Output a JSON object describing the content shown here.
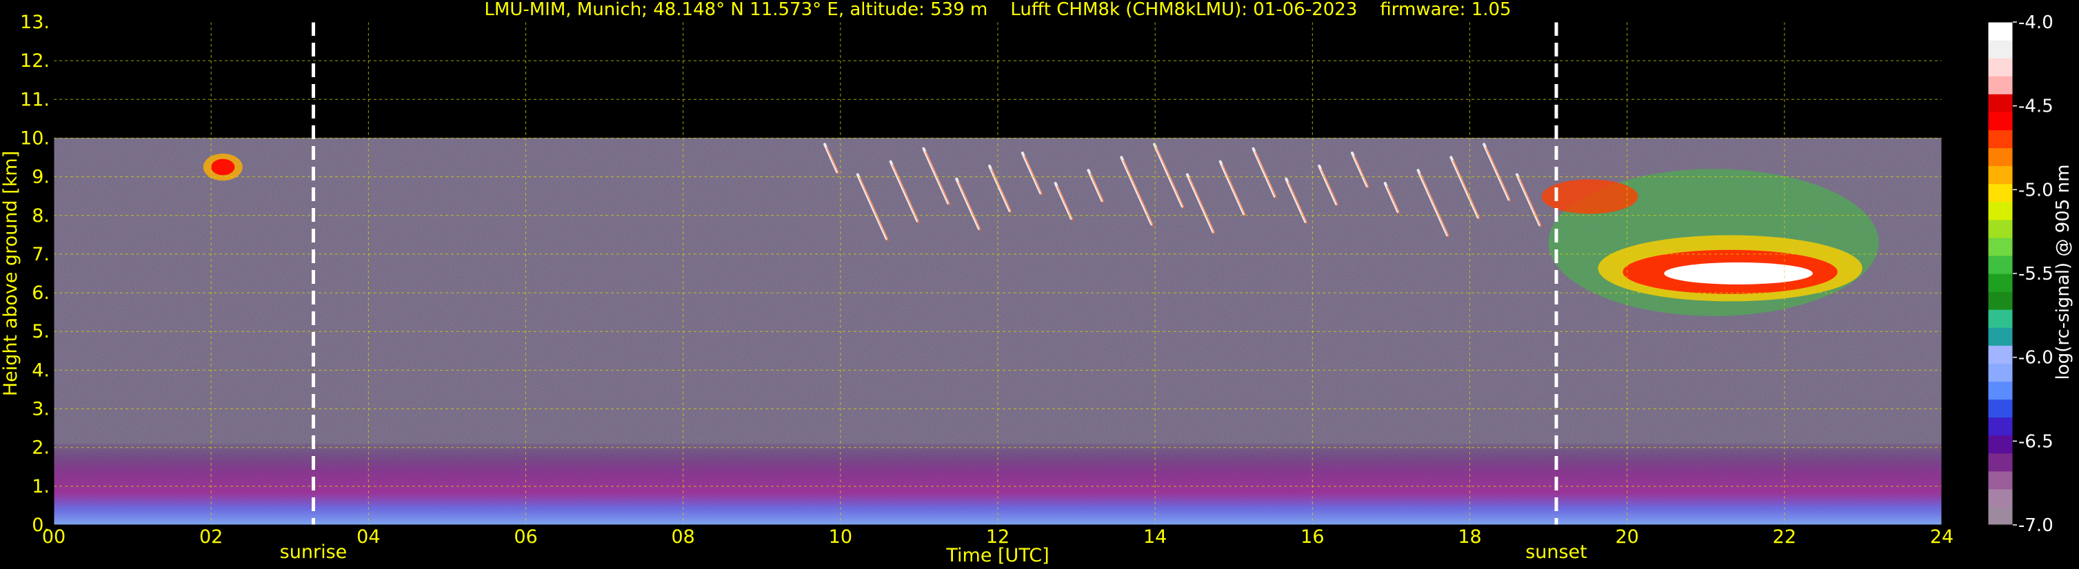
{
  "chart_data": {
    "type": "heatmap",
    "title": "LMU-MIM, Munich; 48.148° N 11.573° E, altitude: 539 m    Lufft CHM8k (CHM8kLMU): 01-06-2023    firmware: 1.05",
    "xlabel": "Time [UTC]",
    "ylabel": "Height above ground [km]",
    "xlim": [
      0,
      24
    ],
    "ylim": [
      0,
      13
    ],
    "x_ticks": [
      "00",
      "02",
      "04",
      "06",
      "08",
      "10",
      "12",
      "14",
      "16",
      "18",
      "20",
      "22",
      "24"
    ],
    "y_ticks": [
      "0.",
      "1.",
      "2.",
      "3.",
      "4.",
      "5.",
      "6.",
      "7.",
      "8.",
      "9.",
      "10.",
      "11.",
      "12.",
      "13."
    ],
    "grid": true,
    "colorbar": {
      "label": "log(rc-signal) @ 905 nm",
      "range": [
        -7.0,
        -4.0
      ],
      "ticks": [
        "-4.0",
        "-4.5",
        "-5.0",
        "-5.5",
        "-6.0",
        "-6.5",
        "-7.0"
      ],
      "colors": [
        "#9e8a9e",
        "#a683a6",
        "#9a5e9a",
        "#7a2a8c",
        "#5a0f9a",
        "#4020c8",
        "#3050e8",
        "#5a8cff",
        "#8aaaff",
        "#a0b4ff",
        "#20a0a0",
        "#30c090",
        "#1a8a1a",
        "#20a020",
        "#40c040",
        "#70d840",
        "#a0e020",
        "#d8f000",
        "#ffe000",
        "#ffb000",
        "#ff8000",
        "#ff4000",
        "#ff0000",
        "#e00000",
        "#ffb0b0",
        "#ffd8d8",
        "#f0f0f0",
        "#ffffff"
      ]
    },
    "annotations": [
      {
        "label": "sunrise",
        "x": 3.3
      },
      {
        "label": "sunset",
        "x": 19.1
      }
    ],
    "data_top_km": 10.0,
    "features": [
      {
        "name": "boundary-layer-aerosol",
        "x_start": 0,
        "x_end": 24,
        "y_bottom": 0,
        "y_top": 2.1
      },
      {
        "name": "cloud-morning",
        "x_start": 1.9,
        "x_end": 2.4,
        "y_bottom": 8.9,
        "y_top": 9.6
      },
      {
        "name": "cirrus-afternoon",
        "x_start": 9.8,
        "x_end": 18.6,
        "y_bottom": 6.8,
        "y_top": 10.0
      },
      {
        "name": "cloud-evening",
        "x_start": 19.0,
        "x_end": 23.2,
        "y_bottom": 5.4,
        "y_top": 9.2
      }
    ]
  }
}
